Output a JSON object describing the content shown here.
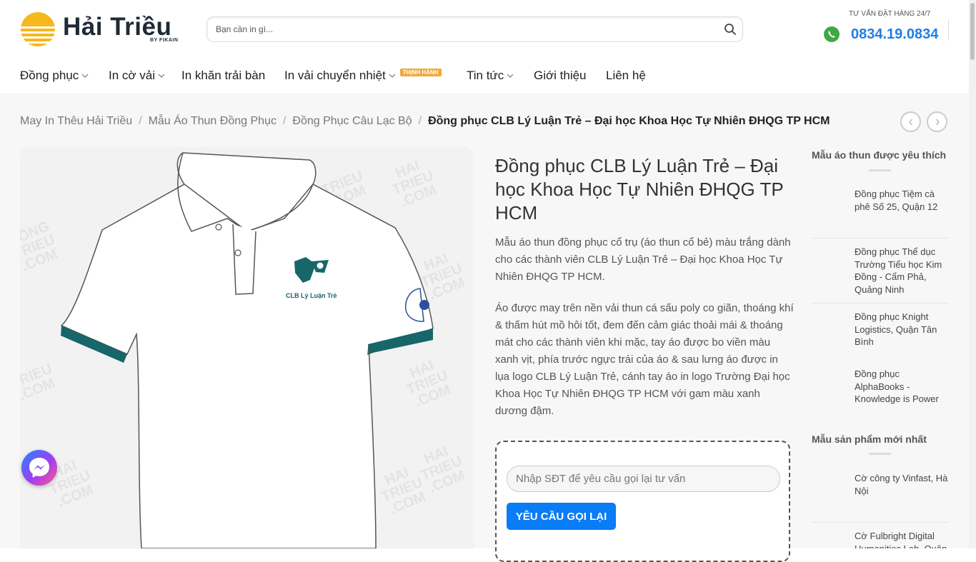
{
  "header": {
    "logo_text": "Hải Triều",
    "logo_sub": "BY FIKAIN",
    "search_placeholder": "Bạn cần in gì...",
    "hotline_label": "TƯ VẤN ĐẶT HÀNG 24/7",
    "hotline_number": "0834.19.0834"
  },
  "nav": {
    "items": [
      {
        "label": "Đồng phục",
        "dropdown": true
      },
      {
        "label": "In cờ vải",
        "dropdown": true
      },
      {
        "label": "In khăn trải bàn",
        "dropdown": false
      },
      {
        "label": "In vải chuyển nhiệt",
        "dropdown": true,
        "badge": "THỊNH HÀNH"
      },
      {
        "label": "Tin tức",
        "dropdown": true
      },
      {
        "label": "Giới thiệu",
        "dropdown": false
      },
      {
        "label": "Liên hệ",
        "dropdown": false
      }
    ]
  },
  "breadcrumb": {
    "items": [
      "May In Thêu Hải Triều",
      "Mẫu Áo Thun Đồng Phục",
      "Đồng Phục Câu Lạc Bộ"
    ],
    "separator": "/",
    "current": "Đồng phục CLB Lý Luận Trẻ – Đại học Khoa Học Tự Nhiên ĐHQG TP HCM"
  },
  "product": {
    "title": "Đồng phục CLB Lý Luận Trẻ – Đại học Khoa Học Tự Nhiên ĐHQG TP HCM",
    "description_1": "Mẫu áo thun đồng phục cổ trụ (áo thun cổ bẻ) màu trắng dành cho các thành viên CLB Lý Luận Trẻ – Đại học Khoa Học Tự Nhiên ĐHQG TP HCM.",
    "description_2": "Áo được may trên nền vải thun cá sấu poly co giãn, thoáng khí & thấm hút mồ hôi tốt, đem đến cảm giác thoải mái & thoáng mát cho các thành viên khi mặc, tay áo được bo viền màu xanh vịt, phía trước ngực trái của áo & sau lưng áo được in lụa logo CLB Lý Luận Trẻ, cánh tay áo in logo Trường Đại học Khoa Học Tự Nhiên ĐHQG TP HCM với gam màu xanh dương đậm.",
    "image_logo_text": "CLB Lý Luận Trẻ",
    "image_watermark": "HAI TRIEU .COM"
  },
  "callback": {
    "placeholder": "Nhập SĐT để yêu cầu gọi lại tư vấn",
    "button_label": "YÊU CẦU GỌI LẠI"
  },
  "sidebar": {
    "section_1_title": "Mẫu áo thun được yêu thích",
    "section_1_items": [
      "Đồng phục Tiệm cà phê Số 25, Quận 12",
      "Đồng phục Thể dục Trường Tiểu học Kim Đồng - Cẩm Phả, Quảng Ninh",
      "Đồng phục Knight Logistics, Quận Tân Bình",
      "Đồng phục AlphaBooks - Knowledge is Power"
    ],
    "section_2_title": "Mẫu sản phẩm mới nhất",
    "section_2_items": [
      "Cờ công ty Vinfast, Hà Nội",
      "Cờ Fulbright Digital Humanities Lab, Quận"
    ]
  },
  "colors": {
    "accent_blue": "#0a7cf5",
    "hotline_blue": "#1f7ee3",
    "badge_orange": "#f2a838",
    "collar_teal": "#17666a"
  }
}
